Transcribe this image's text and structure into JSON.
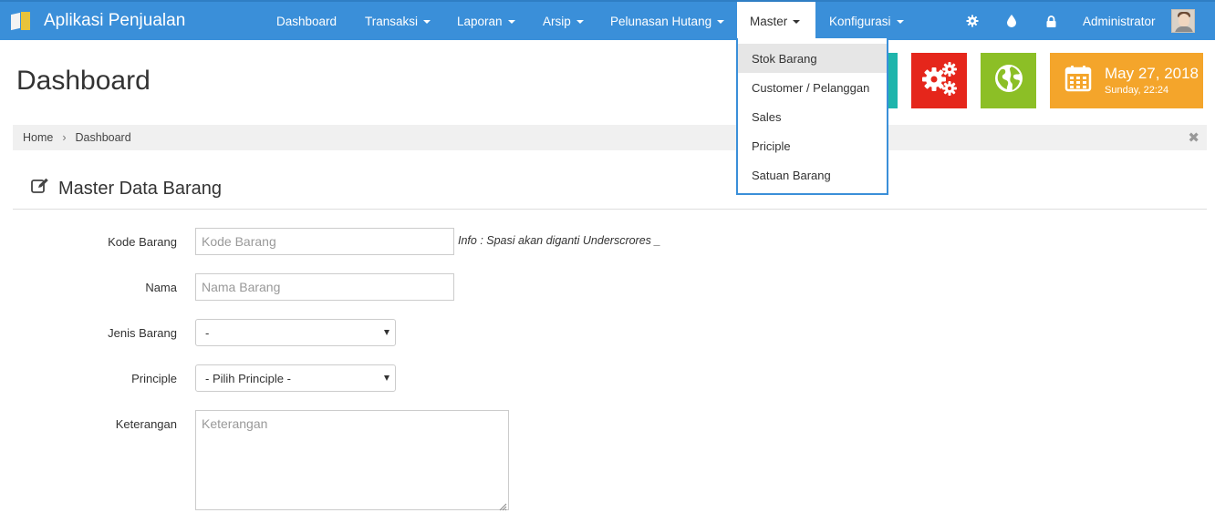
{
  "app": {
    "title": "Aplikasi Penjualan"
  },
  "nav": {
    "items": [
      {
        "label": "Dashboard"
      },
      {
        "label": "Transaksi"
      },
      {
        "label": "Laporan"
      },
      {
        "label": "Arsip"
      },
      {
        "label": "Pelunasan Hutang"
      },
      {
        "label": "Master"
      },
      {
        "label": "Konfigurasi"
      }
    ],
    "icons": [
      "gear-icon",
      "drop-icon",
      "lock-icon"
    ],
    "user": "Administrator"
  },
  "master_menu": {
    "items": [
      {
        "label": "Stok Barang",
        "highlighted": true
      },
      {
        "label": "Customer / Pelanggan"
      },
      {
        "label": "Sales"
      },
      {
        "label": "Priciple"
      },
      {
        "label": "Satuan Barang"
      }
    ]
  },
  "page": {
    "title": "Dashboard"
  },
  "tiles": {
    "date": "May 27, 2018",
    "day_time": "Sunday, 22:24",
    "colors": {
      "teal": "#1fb5ac",
      "red": "#e5261b",
      "green": "#8cbf26",
      "orange": "#f4a52b"
    }
  },
  "breadcrumb": {
    "home": "Home",
    "current": "Dashboard",
    "separator": "›",
    "close": "✖"
  },
  "section": {
    "title": "Master Data Barang"
  },
  "form": {
    "kode": {
      "label": "Kode Barang",
      "placeholder": "Kode Barang",
      "info": "Info : Spasi akan diganti Underscrores _"
    },
    "nama": {
      "label": "Nama",
      "placeholder": "Nama Barang"
    },
    "jenis": {
      "label": "Jenis Barang",
      "value": "-"
    },
    "principle": {
      "label": "Principle",
      "value": "- Pilih Principle -"
    },
    "keterangan": {
      "label": "Keterangan",
      "placeholder": "Keterangan"
    }
  },
  "colors": {
    "navbar": "#3a8fd9",
    "breadcrumb_bg": "#f0f0f0"
  }
}
